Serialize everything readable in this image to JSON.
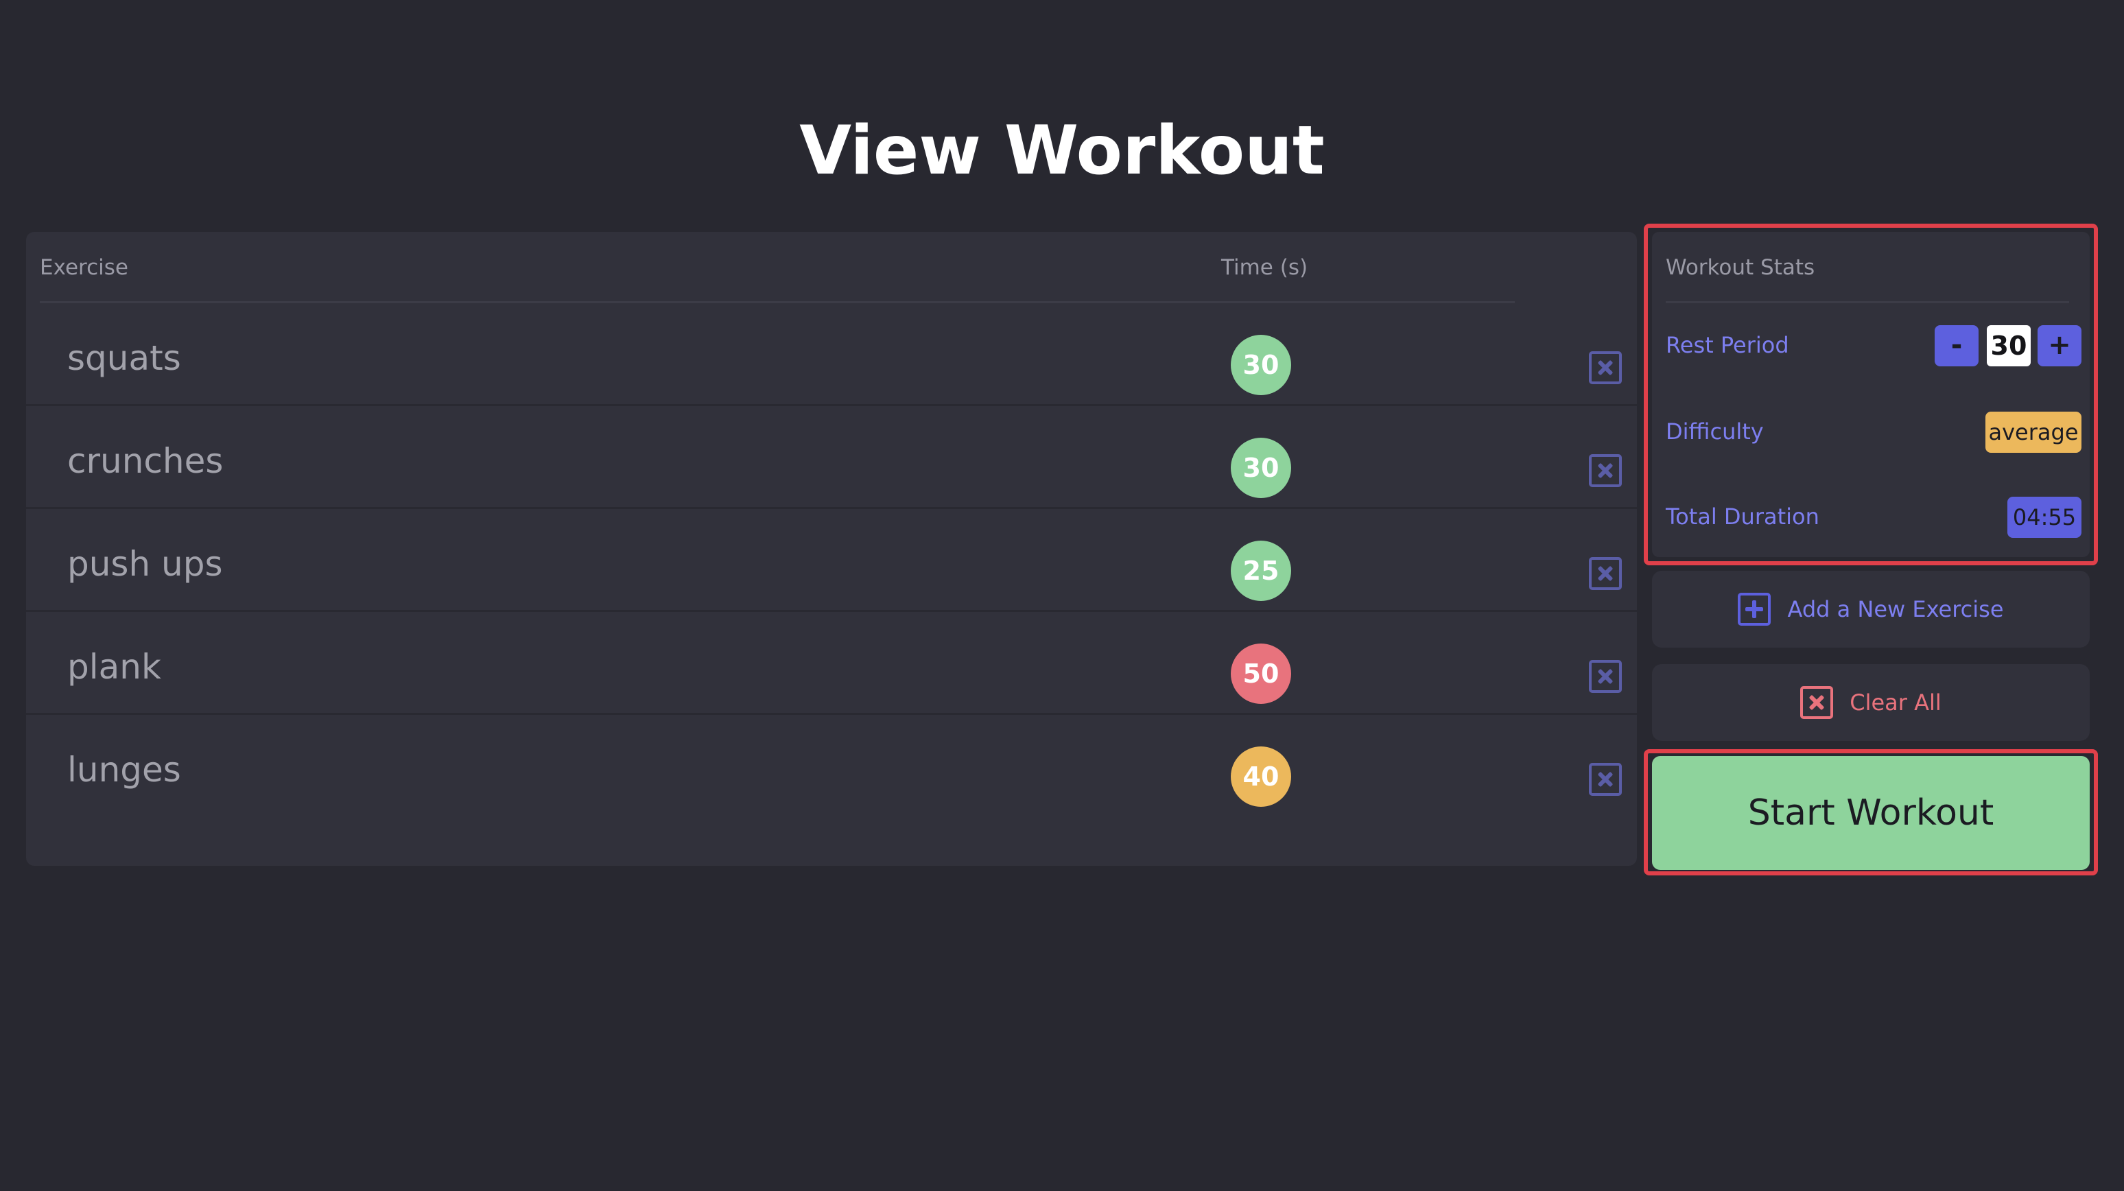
{
  "page": {
    "title": "View Workout"
  },
  "table": {
    "headers": {
      "exercise": "Exercise",
      "time": "Time (s)"
    },
    "rows": [
      {
        "name": "squats",
        "time": "30",
        "badge_color": "#8ed39c"
      },
      {
        "name": "crunches",
        "time": "30",
        "badge_color": "#8ed39c"
      },
      {
        "name": "push ups",
        "time": "25",
        "badge_color": "#8ed39c"
      },
      {
        "name": "plank",
        "time": "50",
        "badge_color": "#e8737d"
      },
      {
        "name": "lunges",
        "time": "40",
        "badge_color": "#ecb85c"
      }
    ],
    "row_action_icon": "close-box-icon"
  },
  "stats": {
    "title": "Workout Stats",
    "rest_period": {
      "label": "Rest Period",
      "value": "30",
      "decrement": "-",
      "increment": "+"
    },
    "difficulty": {
      "label": "Difficulty",
      "value": "average"
    },
    "total_duration": {
      "label": "Total Duration",
      "value": "04:55"
    }
  },
  "actions": {
    "add_exercise": {
      "label": "Add a New Exercise",
      "icon": "plus-box-icon"
    },
    "clear_all": {
      "label": "Clear All",
      "icon": "close-box-icon"
    },
    "start": {
      "label": "Start Workout"
    }
  },
  "colors": {
    "background": "#282830",
    "card": "#31313b",
    "accent": "#5d60de",
    "success": "#8ed39c",
    "danger": "#e9737d",
    "warning": "#ecb85c",
    "highlight_outline": "#e0404a"
  }
}
